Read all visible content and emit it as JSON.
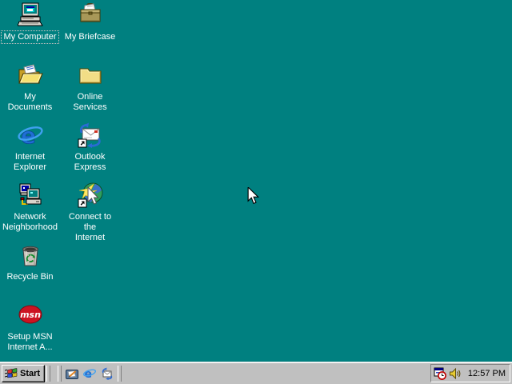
{
  "desktop": {
    "background_color": "#008080",
    "icons": [
      {
        "label": "My Computer",
        "icon": "my-computer-icon",
        "focused": true
      },
      {
        "label": "My Briefcase",
        "icon": "briefcase-icon"
      },
      {
        "label": "My Documents",
        "icon": "open-folder-icon"
      },
      {
        "label": "Online\nServices",
        "icon": "folder-icon"
      },
      {
        "label": "Internet\nExplorer",
        "icon": "internet-explorer-icon"
      },
      {
        "label": "Outlook\nExpress",
        "icon": "outlook-express-icon"
      },
      {
        "label": "Network\nNeighborhood",
        "icon": "network-neighborhood-icon"
      },
      {
        "label": "Connect to the\nInternet",
        "icon": "connect-internet-icon"
      },
      {
        "label": "Recycle Bin",
        "icon": "recycle-bin-icon"
      },
      {
        "label": "Setup MSN\nInternet A...",
        "icon": "msn-icon"
      }
    ]
  },
  "taskbar": {
    "start_label": "Start",
    "quick_launch": [
      {
        "name": "show-desktop"
      },
      {
        "name": "launch-internet-explorer"
      },
      {
        "name": "launch-outlook-express"
      }
    ],
    "tray": {
      "icons": [
        "task-scheduler",
        "volume"
      ],
      "clock": "12:57 PM"
    }
  },
  "colors": {
    "desktop_teal": "#008080",
    "taskbar_gray": "#c0c0c0",
    "label_text": "#ffffff",
    "msn_red": "#cc1322",
    "ie_blue": "#1f6fd4"
  }
}
